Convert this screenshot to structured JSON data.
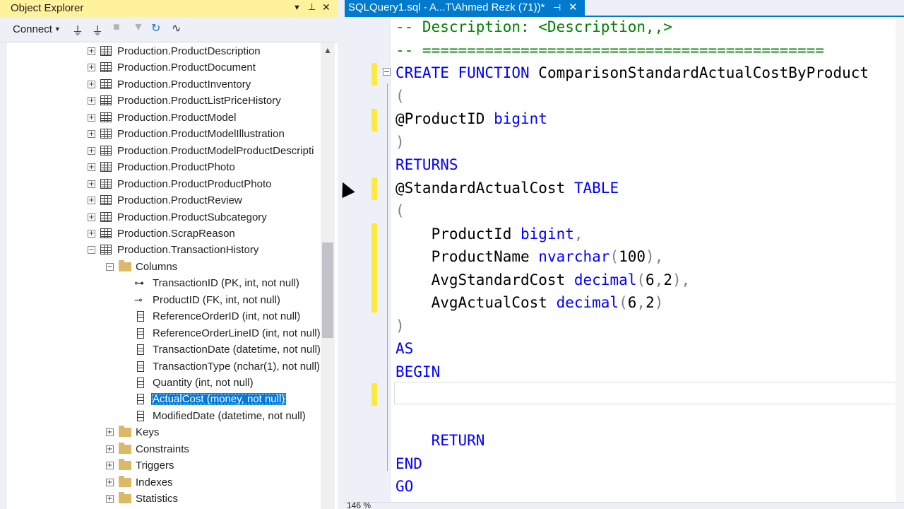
{
  "object_explorer": {
    "title": "Object Explorer",
    "title_buttons": {
      "dropdown": "▼",
      "pin": "📌",
      "close": "✕"
    },
    "toolbar": {
      "connect_label": "Connect",
      "connect_caret": "▼"
    },
    "tree": [
      {
        "level": 1,
        "type": "table",
        "expand": "+",
        "label": "Production.ProductDescription"
      },
      {
        "level": 1,
        "type": "table",
        "expand": "+",
        "label": "Production.ProductDocument"
      },
      {
        "level": 1,
        "type": "table",
        "expand": "+",
        "label": "Production.ProductInventory"
      },
      {
        "level": 1,
        "type": "table",
        "expand": "+",
        "label": "Production.ProductListPriceHistory"
      },
      {
        "level": 1,
        "type": "table",
        "expand": "+",
        "label": "Production.ProductModel"
      },
      {
        "level": 1,
        "type": "table",
        "expand": "+",
        "label": "Production.ProductModelIllustration"
      },
      {
        "level": 1,
        "type": "table",
        "expand": "+",
        "label": "Production.ProductModelProductDescripti"
      },
      {
        "level": 1,
        "type": "table",
        "expand": "+",
        "label": "Production.ProductPhoto"
      },
      {
        "level": 1,
        "type": "table",
        "expand": "+",
        "label": "Production.ProductProductPhoto"
      },
      {
        "level": 1,
        "type": "table",
        "expand": "+",
        "label": "Production.ProductReview"
      },
      {
        "level": 1,
        "type": "table",
        "expand": "+",
        "label": "Production.ProductSubcategory"
      },
      {
        "level": 1,
        "type": "table",
        "expand": "+",
        "label": "Production.ScrapReason"
      },
      {
        "level": 1,
        "type": "table",
        "expand": "−",
        "label": "Production.TransactionHistory"
      },
      {
        "level": 2,
        "type": "folder",
        "expand": "−",
        "label": "Columns"
      },
      {
        "level": 3,
        "type": "pk",
        "label": "TransactionID (PK, int, not null)"
      },
      {
        "level": 3,
        "type": "fk",
        "label": "ProductID (FK, int, not null)"
      },
      {
        "level": 3,
        "type": "column",
        "label": "ReferenceOrderID (int, not null)"
      },
      {
        "level": 3,
        "type": "column",
        "label": "ReferenceOrderLineID (int, not null)"
      },
      {
        "level": 3,
        "type": "column",
        "label": "TransactionDate (datetime, not null)"
      },
      {
        "level": 3,
        "type": "column",
        "label": "TransactionType (nchar(1), not null)"
      },
      {
        "level": 3,
        "type": "column",
        "label": "Quantity (int, not null)"
      },
      {
        "level": 3,
        "type": "column",
        "label": "ActualCost (money, not null)",
        "selected": true
      },
      {
        "level": 3,
        "type": "column",
        "label": "ModifiedDate (datetime, not null)"
      },
      {
        "level": 2,
        "type": "folder",
        "expand": "+",
        "label": "Keys"
      },
      {
        "level": 2,
        "type": "folder",
        "expand": "+",
        "label": "Constraints"
      },
      {
        "level": 2,
        "type": "folder",
        "expand": "+",
        "label": "Triggers"
      },
      {
        "level": 2,
        "type": "folder",
        "expand": "+",
        "label": "Indexes"
      },
      {
        "level": 2,
        "type": "folder",
        "expand": "+",
        "label": "Statistics"
      }
    ]
  },
  "editor": {
    "tab_label": "SQLQuery1.sql - A...T\\Ahmed Rezk (71))*",
    "tab_pin": "⊣",
    "tab_close": "✕",
    "zoom": "146 %",
    "fold_toggle": "−",
    "lines": [
      [
        {
          "c": "cm",
          "t": "-- Description: <Description,,>"
        }
      ],
      [
        {
          "c": "cm",
          "t": "-- ============================================="
        }
      ],
      [
        {
          "c": "kw",
          "t": "CREATE FUNCTION"
        },
        {
          "c": "",
          "t": " ComparisonStandardActualCostByProduct"
        }
      ],
      [
        {
          "c": "gr",
          "t": "("
        }
      ],
      [
        {
          "c": "",
          "t": "@ProductID "
        },
        {
          "c": "kw",
          "t": "bigint"
        }
      ],
      [
        {
          "c": "gr",
          "t": ")"
        }
      ],
      [
        {
          "c": "kw",
          "t": "RETURNS"
        }
      ],
      [
        {
          "c": "",
          "t": "@StandardActualCost "
        },
        {
          "c": "kw",
          "t": "TABLE"
        }
      ],
      [
        {
          "c": "gr",
          "t": "("
        }
      ],
      [
        {
          "c": "",
          "t": "    ProductId "
        },
        {
          "c": "kw",
          "t": "bigint"
        },
        {
          "c": "gr",
          "t": ","
        }
      ],
      [
        {
          "c": "",
          "t": "    ProductName "
        },
        {
          "c": "kw",
          "t": "nvarchar"
        },
        {
          "c": "gr",
          "t": "("
        },
        {
          "c": "",
          "t": "100"
        },
        {
          "c": "gr",
          "t": "),"
        }
      ],
      [
        {
          "c": "",
          "t": "    AvgStandardCost "
        },
        {
          "c": "kw",
          "t": "decimal"
        },
        {
          "c": "gr",
          "t": "("
        },
        {
          "c": "",
          "t": "6"
        },
        {
          "c": "gr",
          "t": ","
        },
        {
          "c": "",
          "t": "2"
        },
        {
          "c": "gr",
          "t": "),"
        }
      ],
      [
        {
          "c": "",
          "t": "    AvgActualCost "
        },
        {
          "c": "kw",
          "t": "decimal"
        },
        {
          "c": "gr",
          "t": "("
        },
        {
          "c": "",
          "t": "6"
        },
        {
          "c": "gr",
          "t": ","
        },
        {
          "c": "",
          "t": "2"
        },
        {
          "c": "gr",
          "t": ")"
        }
      ],
      [
        {
          "c": "gr",
          "t": ")"
        }
      ],
      [
        {
          "c": "kw",
          "t": "AS"
        }
      ],
      [
        {
          "c": "kw",
          "t": "BEGIN"
        }
      ],
      [],
      [],
      [
        {
          "c": "",
          "t": "    "
        },
        {
          "c": "kw",
          "t": "RETURN"
        }
      ],
      [
        {
          "c": "kw",
          "t": "END"
        }
      ],
      [
        {
          "c": "kw",
          "t": "GO"
        }
      ]
    ]
  },
  "colors": {
    "accent": "#007acc",
    "selection": "#0078d7",
    "title_bar": "#fff29d",
    "change_marker": "#ffe83f",
    "keyword": "#0000ff",
    "comment": "#008000"
  }
}
